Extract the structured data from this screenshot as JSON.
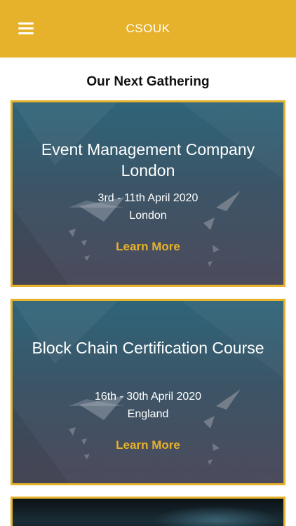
{
  "header": {
    "title": "CSOUK",
    "menu_icon": "hamburger-menu-icon"
  },
  "section": {
    "title": "Our Next Gathering"
  },
  "events": [
    {
      "title": "Event Management Company London",
      "dates": "3rd - 11th April 2020",
      "location": "London",
      "link_label": "Learn More"
    },
    {
      "title": "Block Chain Certification Course",
      "dates": "16th - 30th April 2020",
      "location": "England",
      "link_label": "Learn More"
    }
  ],
  "colors": {
    "accent": "#e6b22b",
    "card_top": "#2f6479",
    "card_bottom": "#4c4b5c"
  }
}
